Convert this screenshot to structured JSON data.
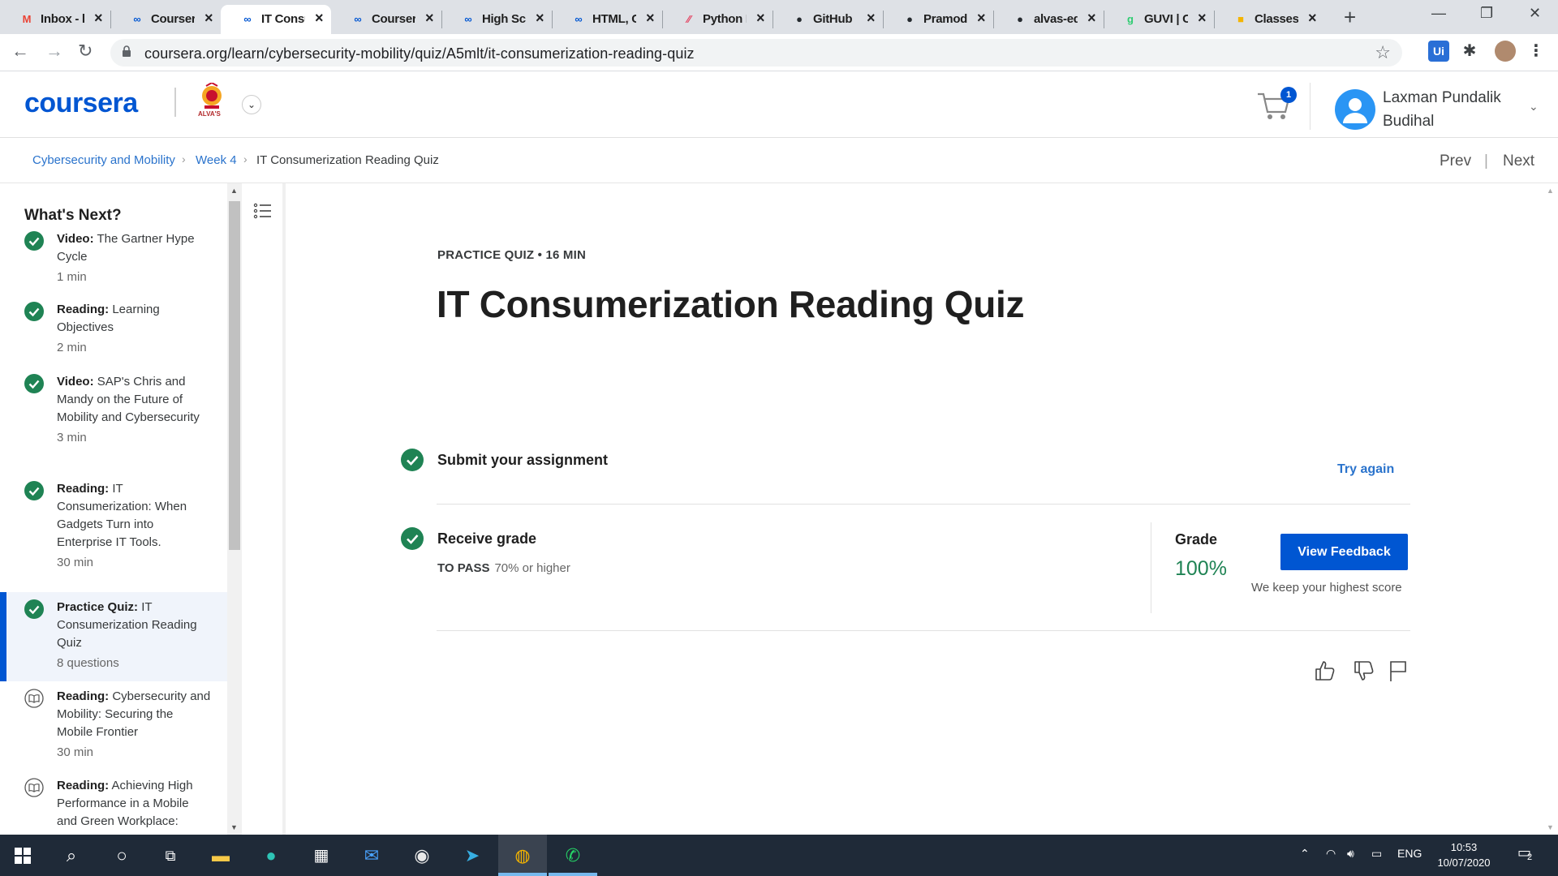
{
  "browser": {
    "tabs": [
      {
        "label": "Inbox - l",
        "favicon": "gmail-icon",
        "color": "#ea4335",
        "glyph": "M"
      },
      {
        "label": "Coursera",
        "favicon": "coursera-icon",
        "color": "#0056d2",
        "glyph": "∞"
      },
      {
        "label": "IT Consu",
        "favicon": "coursera-icon",
        "color": "#0056d2",
        "glyph": "∞",
        "active": true
      },
      {
        "label": "Coursera",
        "favicon": "coursera-icon",
        "color": "#0056d2",
        "glyph": "∞"
      },
      {
        "label": "High Sc",
        "favicon": "coursera-icon",
        "color": "#0056d2",
        "glyph": "∞"
      },
      {
        "label": "HTML, C",
        "favicon": "coursera-icon",
        "color": "#0056d2",
        "glyph": "∞"
      },
      {
        "label": "Python E",
        "favicon": "python-icon",
        "color": "#e4405f",
        "glyph": "∕∕"
      },
      {
        "label": "GitHub",
        "favicon": "github-icon",
        "color": "#24292e",
        "glyph": "●"
      },
      {
        "label": "Pramod",
        "favicon": "github-icon",
        "color": "#24292e",
        "glyph": "●"
      },
      {
        "label": "alvas-ed",
        "favicon": "github-icon",
        "color": "#24292e",
        "glyph": "●"
      },
      {
        "label": "GUVI | C",
        "favicon": "guvi-icon",
        "color": "#2ecc71",
        "glyph": "g"
      },
      {
        "label": "Classes",
        "favicon": "classroom-icon",
        "color": "#f4b400",
        "glyph": "■"
      }
    ],
    "url": "coursera.org/learn/cybersecurity-mobility/quiz/A5mlt/it-consumerization-reading-quiz"
  },
  "header": {
    "logo": "coursera",
    "university_caption": "ALVA'S",
    "cart_count": "1",
    "user_name": "Laxman Pundalik Budihal"
  },
  "breadcrumb": {
    "course": "Cybersecurity and Mobility",
    "week": "Week 4",
    "current": "IT Consumerization Reading Quiz",
    "prev": "Prev",
    "next": "Next"
  },
  "sidebar": {
    "heading": "What's Next?",
    "items": [
      {
        "type": "Video:",
        "title": "The Gartner Hype Cycle",
        "meta": "1 min",
        "status": "done"
      },
      {
        "type": "Reading:",
        "title": "Learning Objectives",
        "meta": "2 min",
        "status": "done"
      },
      {
        "type": "Video:",
        "title": "SAP's Chris and Mandy on the Future of Mobility and Cybersecurity",
        "meta": "3 min",
        "status": "done"
      },
      {
        "type": "Reading:",
        "title": "IT Consumerization: When Gadgets Turn into Enterprise IT Tools.",
        "meta": "30 min",
        "status": "done"
      },
      {
        "type": "Practice Quiz:",
        "title": "IT Consumerization Reading Quiz",
        "meta": "8 questions",
        "status": "done",
        "active": true
      },
      {
        "type": "Reading:",
        "title": "Cybersecurity and Mobility: Securing the Mobile Frontier",
        "meta": "30 min",
        "status": "todo"
      },
      {
        "type": "Reading:",
        "title": "Achieving High Performance in a Mobile and Green Workplace:",
        "meta": "",
        "status": "todo"
      }
    ]
  },
  "main": {
    "eyebrow": "PRACTICE QUIZ • 16 MIN",
    "title": "IT Consumerization Reading Quiz",
    "submit_label": "Submit your assignment",
    "try_again": "Try again",
    "receive_label": "Receive grade",
    "to_pass_label": "TO PASS",
    "to_pass_value": "70% or higher",
    "grade_label": "Grade",
    "grade_value": "100%",
    "view_feedback": "View Feedback",
    "keep_note": "We keep your highest score"
  },
  "taskbar": {
    "lang": "ENG",
    "time": "10:53",
    "date": "10/07/2020",
    "notifications": "2"
  },
  "colors": {
    "accent": "#0056d2",
    "success": "#1f8354",
    "link": "#2a73cc"
  }
}
